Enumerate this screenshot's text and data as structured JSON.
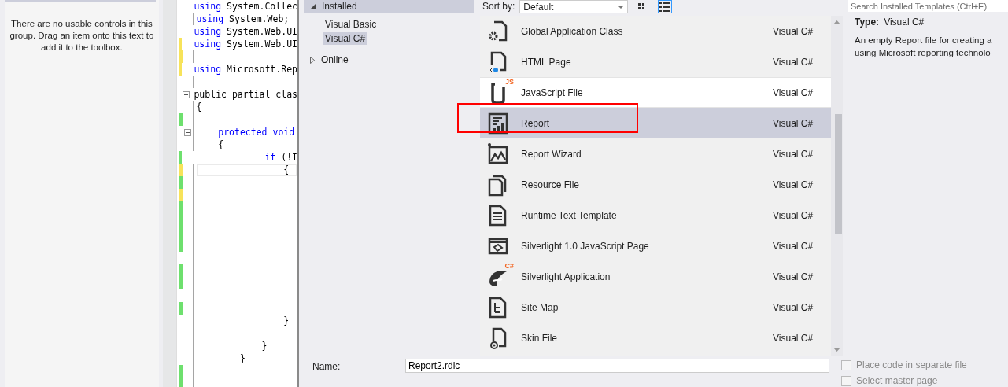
{
  "toolbox": {
    "message": "There are no usable controls in this group. Drag an item onto this text to add it to the toolbox."
  },
  "editor": {
    "blocks": [
      {
        "lines": [
          {
            "text": "using System.Collec"
          },
          {
            "text": "using System.Web;"
          },
          {
            "text": "using System.Web.UI"
          },
          {
            "text": "using System.Web.UI",
            "color": "#f7e35a"
          },
          {
            "color": "#f7e35a"
          },
          {
            "text": "using Microsoft.Rep",
            "color": "#f7e35a"
          }
        ]
      },
      {
        "lines": [
          {
            "text": "public partial clas",
            "fold": true
          },
          {
            "text": "{"
          },
          {
            "color": "#6ee06e"
          },
          {
            "text": "    protected void",
            "fold": true
          },
          {
            "text": "    {"
          },
          {
            "text": "             if (!I",
            "color": "#6ee06e"
          },
          {
            "text": "                {",
            "color": "#f7e35a",
            "current": true
          },
          {
            "color": "#6ee06e"
          },
          {
            "color": "#f7e35a"
          },
          {
            "color": "#6ee06e"
          },
          {
            "color": "#6ee06e"
          },
          {
            "color": "#6ee06e"
          },
          {
            "color": "#6ee06e"
          }
        ]
      },
      {
        "lines": [
          {
            "color": "#6ee06e"
          },
          {
            "color": "#6ee06e"
          }
        ]
      },
      {
        "lines": [
          {
            "color": "#6ee06e"
          },
          {
            "text": "                }"
          }
        ]
      },
      {
        "lines": [
          {
            "text": "            }"
          },
          {
            "text": "        }"
          },
          {
            "color": "#6ee06e"
          },
          {
            "color": "#6ee06e"
          }
        ]
      }
    ]
  },
  "dialog": {
    "tree": [
      {
        "label": "Installed",
        "expanded": true,
        "children": [
          {
            "label": "Visual Basic",
            "selected": false
          },
          {
            "label": "Visual C#",
            "selected": true
          }
        ]
      },
      {
        "label": "Online",
        "expanded": false
      }
    ],
    "sort": {
      "label": "Sort by:",
      "value": "Default",
      "views": [
        {
          "selected": false
        },
        {
          "selected": true
        }
      ]
    },
    "search": {
      "placeholder": "Search Installed Templates (Ctrl+E)"
    },
    "templates": [
      {
        "kind": "class",
        "name": "Global Application Class",
        "language": "Visual C#",
        "selected": false,
        "hovered": false,
        "annotated": false
      },
      {
        "kind": "page",
        "name": "HTML Page",
        "language": "Visual C#",
        "selected": false,
        "hovered": false,
        "annotated": false
      },
      {
        "kind": "script",
        "name": "JavaScript File",
        "language": "Visual C#",
        "selected": false,
        "hovered": true,
        "annotated": false,
        "badge": "JS"
      },
      {
        "kind": "report",
        "name": "Report",
        "language": "Visual C#",
        "selected": true,
        "hovered": false,
        "annotated": true
      },
      {
        "kind": "wizard",
        "name": "Report Wizard",
        "language": "Visual C#",
        "selected": false,
        "hovered": false,
        "annotated": false
      },
      {
        "kind": "resource",
        "name": "Resource File",
        "language": "Visual C#",
        "selected": false,
        "hovered": false,
        "annotated": false
      },
      {
        "kind": "text",
        "name": "Runtime Text Template",
        "language": "Visual C#",
        "selected": false,
        "hovered": false,
        "annotated": false
      },
      {
        "kind": "silverlight",
        "name": "Silverlight 1.0 JavaScript Page",
        "language": "Visual C#",
        "selected": false,
        "hovered": false,
        "annotated": false
      },
      {
        "kind": "app",
        "name": "Silverlight Application",
        "language": "Visual C#",
        "selected": false,
        "hovered": false,
        "annotated": false,
        "badge": "C#"
      },
      {
        "kind": "sitemap",
        "name": "Site Map",
        "language": "Visual C#",
        "selected": false,
        "hovered": false,
        "annotated": false
      },
      {
        "kind": "skin",
        "name": "Skin File",
        "language": "Visual C#",
        "selected": false,
        "hovered": false,
        "annotated": false
      }
    ],
    "details": {
      "type_label": "Type:",
      "type_value": "Visual C#",
      "description": [
        "An empty Report file for creating a",
        "using Microsoft reporting technolo"
      ]
    },
    "name_field": {
      "label": "Name:",
      "value": "Report2.rdlc"
    },
    "options": [
      {
        "label": "Place code in separate file",
        "checked": false,
        "disabled": true
      },
      {
        "label": "Select master page",
        "checked": false,
        "disabled": true
      }
    ]
  }
}
